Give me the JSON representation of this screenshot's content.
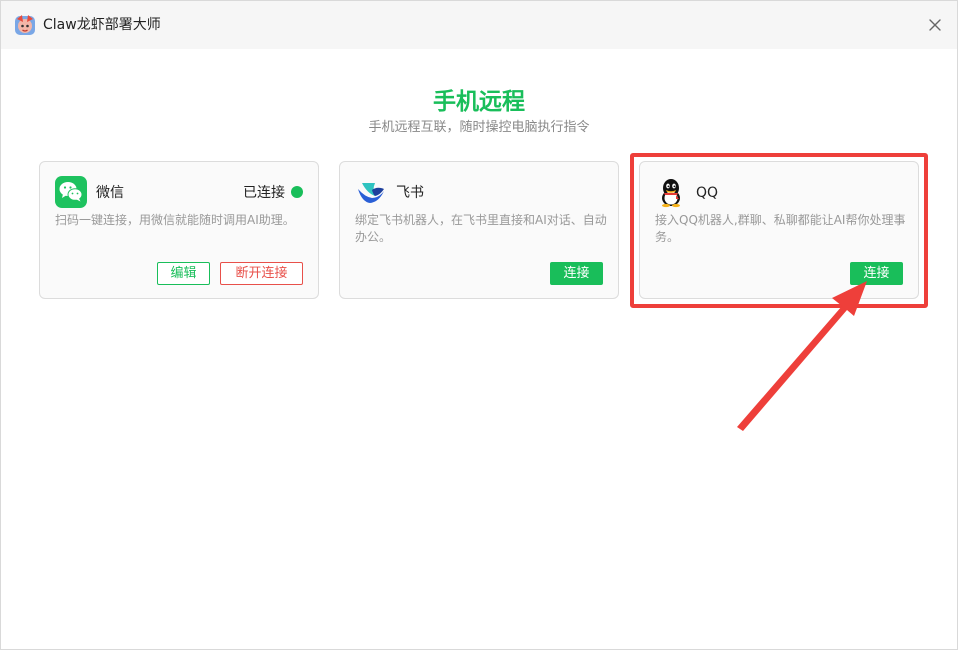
{
  "window": {
    "title": "Claw龙虾部署大师",
    "close_icon": "close-icon"
  },
  "page": {
    "title": "手机远程",
    "subtitle": "手机远程互联，随时操控电脑执行指令"
  },
  "cards": [
    {
      "name": "微信",
      "icon": "wechat-icon",
      "status": "已连接",
      "status_color": "#19be5a",
      "description": "扫码一键连接，用微信就能随时调用AI助理。",
      "buttons": {
        "edit": "编辑",
        "disconnect": "断开连接"
      }
    },
    {
      "name": "飞书",
      "icon": "feishu-icon",
      "description": "绑定飞书机器人，在飞书里直接和AI对话、自动办公。",
      "buttons": {
        "connect": "连接"
      }
    },
    {
      "name": "QQ",
      "icon": "qq-icon",
      "description": "接入QQ机器人,群聊、私聊都能让AI帮你处理事务。",
      "buttons": {
        "connect": "连接"
      }
    }
  ],
  "colors": {
    "accent": "#19be5a",
    "danger": "#e8504a",
    "annotation": "#ee3f3a"
  }
}
